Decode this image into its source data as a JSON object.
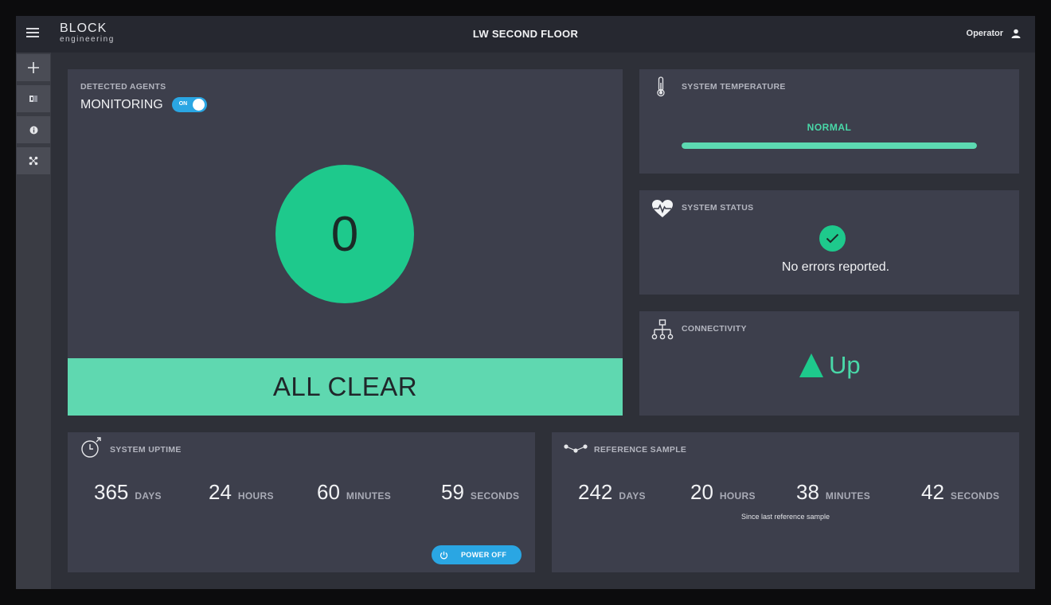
{
  "header": {
    "logo_line1": "BLOCK",
    "logo_line2": "engineering",
    "title": "LW SECOND FLOOR",
    "user": "Operator",
    "menu_icon": "hamburger-menu-icon",
    "user_icon": "person-icon"
  },
  "sidebar": {
    "items": [
      {
        "icon": "plus-icon"
      },
      {
        "icon": "flag-icon"
      },
      {
        "icon": "info-icon"
      },
      {
        "icon": "network-nodes-icon"
      }
    ]
  },
  "agents": {
    "heading": "DETECTED AGENTS",
    "monitoring_label": "MONITORING",
    "toggle_label": "ON",
    "toggle_state": true,
    "count": "0",
    "status": "ALL CLEAR",
    "status_color": "#5fd8b0",
    "circle_color": "#1ec98c"
  },
  "temperature": {
    "heading": "SYSTEM TEMPERATURE",
    "icon": "thermometer-icon",
    "state": "NORMAL",
    "level_fraction": 1.0
  },
  "status": {
    "heading": "SYSTEM STATUS",
    "icon": "heart-pulse-icon",
    "check_icon": "checkmark-icon",
    "message": "No errors reported."
  },
  "connectivity": {
    "heading": "CONNECTIVITY",
    "icon": "network-tree-icon",
    "state_icon": "up-triangle-icon",
    "state": "Up"
  },
  "uptime": {
    "heading": "SYSTEM UPTIME",
    "icon": "stopwatch-icon",
    "days": "365",
    "days_label": "DAYS",
    "hours": "24",
    "hours_label": "HOURS",
    "minutes": "60",
    "minutes_label": "MINUTES",
    "seconds": "59",
    "seconds_label": "SECONDS",
    "power_label": "POWER OFF",
    "power_icon": "power-icon"
  },
  "reference": {
    "heading": "REFERENCE SAMPLE",
    "icon": "sample-link-icon",
    "days": "242",
    "days_label": "DAYS",
    "hours": "20",
    "hours_label": "HOURS",
    "minutes": "38",
    "minutes_label": "MINUTES",
    "seconds": "42",
    "seconds_label": "SECONDS",
    "since_text": "Since last reference sample"
  },
  "colors": {
    "accent_green": "#1ec98c",
    "accent_blue": "#2aa6e3",
    "card_bg": "#3d3f4c",
    "page_bg": "#2e3038"
  }
}
